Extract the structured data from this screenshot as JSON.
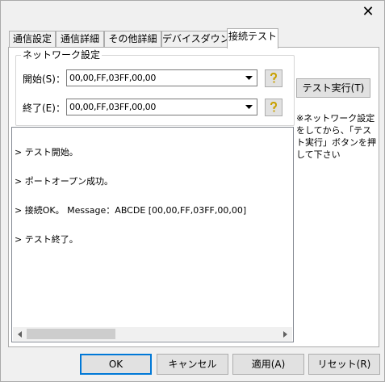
{
  "window": {
    "close_glyph": "✕"
  },
  "tabs": [
    {
      "label": "通信設定"
    },
    {
      "label": "通信詳細"
    },
    {
      "label": "その他詳細"
    },
    {
      "label": "デバイスダウン"
    },
    {
      "label": "接続テスト"
    }
  ],
  "network": {
    "group_title": "ネットワーク設定",
    "start_label": "開始(S)：",
    "start_value": "00,00,FF,03FF,00,00",
    "end_label": "終了(E)：",
    "end_value": "00,00,FF,03FF,00,00",
    "help_icon": "question-icon",
    "dropdown_icon": "chevron-down-icon"
  },
  "exec_button_label": "テスト実行(T)",
  "note_text": "※ネットワーク設定をしてから、「テスト実行」ボタンを押して下さい",
  "log_lines": [
    "> テスト開始。",
    "> ポートオープン成功。",
    "> 接続OK。 Message：ABCDE [00,00,FF,03FF,00,00]",
    "> テスト終了。"
  ],
  "buttons": {
    "ok": "OK",
    "cancel": "キャンセル",
    "apply": "適用(A)",
    "reset": "リセット(R)"
  },
  "colors": {
    "help_icon": "#c8a000",
    "accent": "#0078d7"
  }
}
